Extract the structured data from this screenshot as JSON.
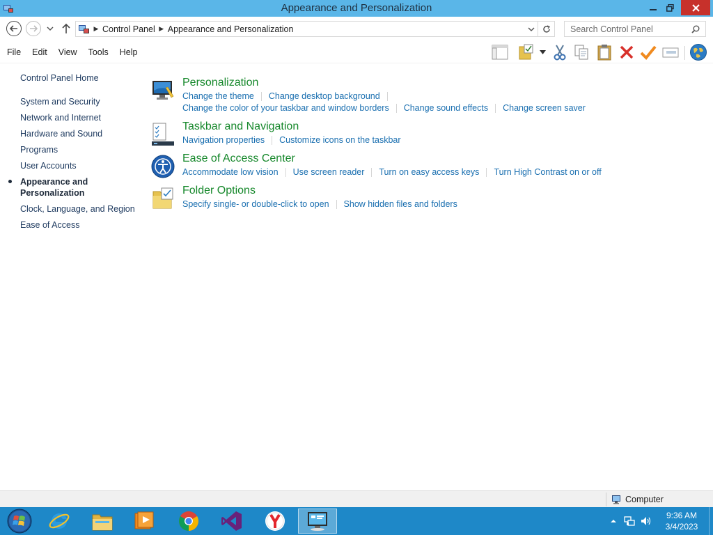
{
  "window": {
    "title": "Appearance and Personalization",
    "minimize_label": "Minimize",
    "maximize_label": "Restore",
    "close_label": "Close"
  },
  "address": {
    "crumbs": [
      "Control Panel",
      "Appearance and Personalization"
    ],
    "search_placeholder": "Search Control Panel"
  },
  "menu": {
    "items": [
      "File",
      "Edit",
      "View",
      "Tools",
      "Help"
    ]
  },
  "toolbar": {
    "icons": [
      "layout-icon",
      "folder-check-icon",
      "cut-icon",
      "copy-icon",
      "paste-icon",
      "delete-icon",
      "checkmark-icon",
      "rename-icon",
      "globe-icon"
    ]
  },
  "sidebar": {
    "home": "Control Panel Home",
    "items": [
      {
        "label": "System and Security"
      },
      {
        "label": "Network and Internet"
      },
      {
        "label": "Hardware and Sound"
      },
      {
        "label": "Programs"
      },
      {
        "label": "User Accounts"
      },
      {
        "label": "Appearance and Personalization",
        "active": true
      },
      {
        "label": "Clock, Language, and Region"
      },
      {
        "label": "Ease of Access"
      }
    ]
  },
  "categories": [
    {
      "title": "Personalization",
      "icon": "personalization-icon",
      "link_rows": [
        [
          "Change the theme",
          "Change desktop background"
        ],
        [
          "Change the color of your taskbar and window borders",
          "Change sound effects",
          "Change screen saver"
        ]
      ]
    },
    {
      "title": "Taskbar and Navigation",
      "icon": "taskbar-icon",
      "link_rows": [
        [
          "Navigation properties",
          "Customize icons on the taskbar"
        ]
      ]
    },
    {
      "title": "Ease of Access Center",
      "icon": "ease-of-access-icon",
      "link_rows": [
        [
          "Accommodate low vision",
          "Use screen reader",
          "Turn on easy access keys",
          "Turn High Contrast on or off"
        ]
      ]
    },
    {
      "title": "Folder Options",
      "icon": "folder-options-icon",
      "link_rows": [
        [
          "Specify single- or double-click to open",
          "Show hidden files and folders"
        ]
      ]
    }
  ],
  "statusbar": {
    "location": "Computer"
  },
  "taskbar": {
    "apps": [
      "start-orb-icon",
      "internet-explorer-icon",
      "file-explorer-icon",
      "media-player-icon",
      "chrome-icon",
      "visual-studio-icon",
      "yandex-browser-icon",
      "control-panel-icon"
    ],
    "time": "9:36 AM",
    "date": "3/4/2023"
  },
  "colors": {
    "titlebar": "#5ab6e8",
    "category_title": "#16882b",
    "link": "#1a6fb0",
    "taskbar": "#1e88c8",
    "close_button": "#c7312b"
  }
}
